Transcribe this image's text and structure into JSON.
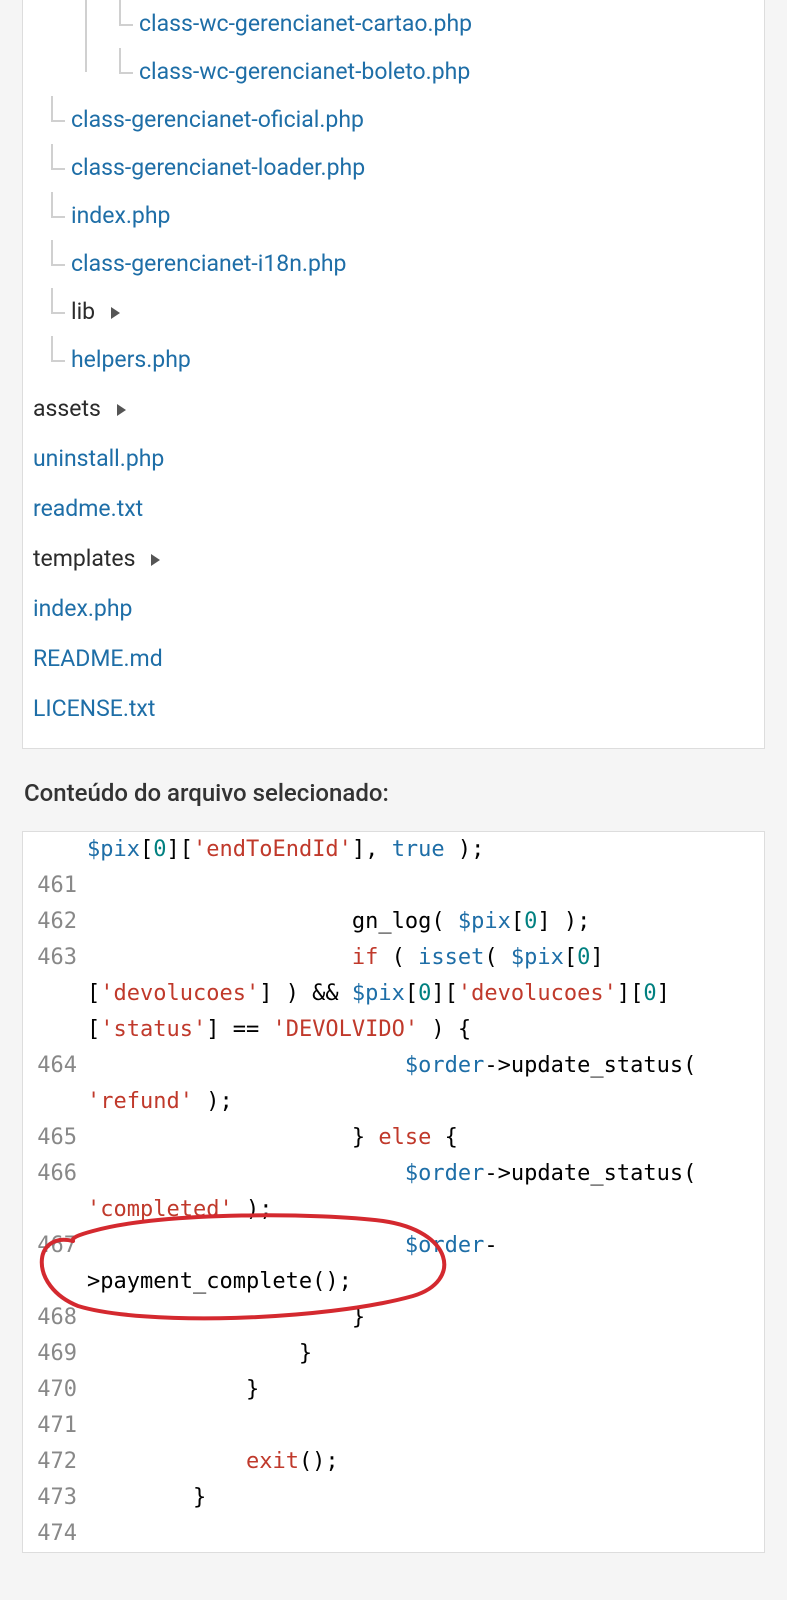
{
  "tree": {
    "nested": [
      "class-wc-gerencianet-cartao.php",
      "class-wc-gerencianet-boleto.php"
    ],
    "mid_files": [
      "class-gerencianet-oficial.php",
      "class-gerencianet-loader.php",
      "index.php",
      "class-gerencianet-i18n.php"
    ],
    "lib_folder": "lib",
    "helpers": "helpers.php",
    "roots": [
      {
        "type": "folder",
        "label": "assets"
      },
      {
        "type": "file",
        "label": "uninstall.php"
      },
      {
        "type": "file",
        "label": "readme.txt"
      },
      {
        "type": "folder",
        "label": "templates"
      },
      {
        "type": "file",
        "label": "index.php"
      },
      {
        "type": "file",
        "label": "README.md"
      },
      {
        "type": "file",
        "label": "LICENSE.txt"
      }
    ]
  },
  "section_title": "Conteúdo do arquivo selecionado:",
  "code": {
    "lines": [
      {
        "n": "",
        "segs": [
          {
            "c": "var",
            "t": "$pix"
          },
          {
            "c": "pl",
            "t": "["
          },
          {
            "c": "num",
            "t": "0"
          },
          {
            "c": "pl",
            "t": "]["
          },
          {
            "c": "str",
            "t": "'endToEndId'"
          },
          {
            "c": "pl",
            "t": "], "
          },
          {
            "c": "bool",
            "t": "true"
          },
          {
            "c": "pl",
            "t": " );"
          }
        ]
      },
      {
        "n": "461",
        "segs": []
      },
      {
        "n": "462",
        "segs": [
          {
            "c": "pl",
            "t": "                    "
          },
          {
            "c": "fn",
            "t": "gn_log"
          },
          {
            "c": "pl",
            "t": "( "
          },
          {
            "c": "var",
            "t": "$pix"
          },
          {
            "c": "pl",
            "t": "["
          },
          {
            "c": "num",
            "t": "0"
          },
          {
            "c": "pl",
            "t": "] );"
          }
        ]
      },
      {
        "n": "463",
        "segs": [
          {
            "c": "pl",
            "t": "                    "
          },
          {
            "c": "kw",
            "t": "if"
          },
          {
            "c": "pl",
            "t": " ( "
          },
          {
            "c": "bool",
            "t": "isset"
          },
          {
            "c": "pl",
            "t": "( "
          },
          {
            "c": "var",
            "t": "$pix"
          },
          {
            "c": "pl",
            "t": "["
          },
          {
            "c": "num",
            "t": "0"
          },
          {
            "c": "pl",
            "t": "]["
          },
          {
            "c": "str",
            "t": "'devolucoes'"
          },
          {
            "c": "pl",
            "t": "] ) && "
          },
          {
            "c": "var",
            "t": "$pix"
          },
          {
            "c": "pl",
            "t": "["
          },
          {
            "c": "num",
            "t": "0"
          },
          {
            "c": "pl",
            "t": "]["
          },
          {
            "c": "str",
            "t": "'devolucoes'"
          },
          {
            "c": "pl",
            "t": "]["
          },
          {
            "c": "num",
            "t": "0"
          },
          {
            "c": "pl",
            "t": "]["
          },
          {
            "c": "str",
            "t": "'status'"
          },
          {
            "c": "pl",
            "t": "] == "
          },
          {
            "c": "str",
            "t": "'DEVOLVIDO'"
          },
          {
            "c": "pl",
            "t": " ) {"
          }
        ]
      },
      {
        "n": "464",
        "segs": [
          {
            "c": "pl",
            "t": "                        "
          },
          {
            "c": "var",
            "t": "$order"
          },
          {
            "c": "pl",
            "t": "->"
          },
          {
            "c": "fn",
            "t": "update_status"
          },
          {
            "c": "pl",
            "t": "( "
          },
          {
            "c": "str",
            "t": "'refund'"
          },
          {
            "c": "pl",
            "t": " );"
          }
        ]
      },
      {
        "n": "465",
        "segs": [
          {
            "c": "pl",
            "t": "                    } "
          },
          {
            "c": "kw",
            "t": "else"
          },
          {
            "c": "pl",
            "t": " {"
          }
        ]
      },
      {
        "n": "466",
        "segs": [
          {
            "c": "pl",
            "t": "                        "
          },
          {
            "c": "var",
            "t": "$order"
          },
          {
            "c": "pl",
            "t": "->"
          },
          {
            "c": "fn",
            "t": "update_status"
          },
          {
            "c": "pl",
            "t": "( "
          },
          {
            "c": "str",
            "t": "'completed'"
          },
          {
            "c": "pl",
            "t": " );"
          }
        ]
      },
      {
        "n": "467",
        "segs": [
          {
            "c": "pl",
            "t": "                        "
          },
          {
            "c": "var",
            "t": "$order"
          },
          {
            "c": "pl",
            "t": "->"
          },
          {
            "c": "fn",
            "t": "payment_complete"
          },
          {
            "c": "pl",
            "t": "();"
          }
        ]
      },
      {
        "n": "468",
        "segs": [
          {
            "c": "pl",
            "t": "                    }"
          }
        ]
      },
      {
        "n": "469",
        "segs": [
          {
            "c": "pl",
            "t": "                }"
          }
        ]
      },
      {
        "n": "470",
        "segs": [
          {
            "c": "pl",
            "t": "            }"
          }
        ]
      },
      {
        "n": "471",
        "segs": []
      },
      {
        "n": "472",
        "segs": [
          {
            "c": "pl",
            "t": "            "
          },
          {
            "c": "kw",
            "t": "exit"
          },
          {
            "c": "pl",
            "t": "();"
          }
        ]
      },
      {
        "n": "473",
        "segs": [
          {
            "c": "pl",
            "t": "        }"
          }
        ]
      },
      {
        "n": "474",
        "segs": []
      }
    ]
  },
  "annotation": {
    "kind": "freehand-circle",
    "color": "#d4292f",
    "target_lines": [
      467
    ],
    "target_text": "$order->payment_complete();"
  }
}
